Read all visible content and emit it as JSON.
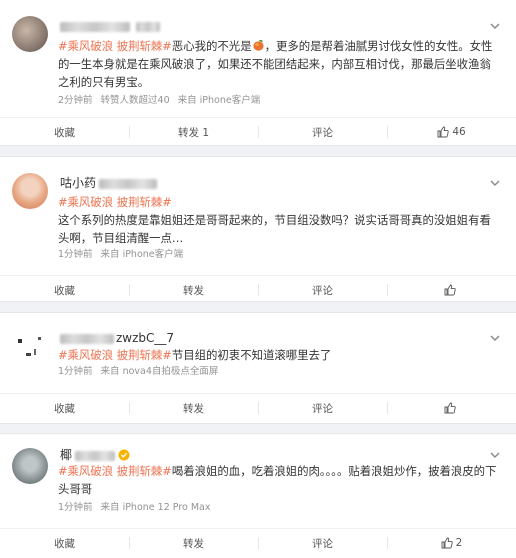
{
  "posts": [
    {
      "name_visible": "",
      "name_suffix": "",
      "text_tags": "#乘风破浪 披荆斩棘#",
      "text_1": "恶心我的不光是",
      "text_2": "，更多的是帮着油腻男讨伐女性的女性。女性的一生本身就是在乘风破浪了，如果还不能团结起来，内部互相讨伐，那最后坐收渔翁之利的只有男宝。",
      "time": "2分钟前",
      "source_prefix": "来自",
      "source": "iPhone客户端",
      "extra": "转赞人数超过40",
      "fav": "收藏",
      "repost": "转发 1",
      "comment": "评论",
      "like": "46"
    },
    {
      "name_visible": "咕小药",
      "name_suffix": "",
      "text_tags": "#乘风破浪 披荆斩棘#",
      "text_body": "这个系列的热度是靠姐姐还是哥哥起来的，节目组没数吗？说实话哥哥真的没姐姐有看头啊，节目组清醒一点…",
      "time": "1分钟前",
      "source_prefix": "来自",
      "source": "iPhone客户端",
      "fav": "收藏",
      "repost": "转发",
      "comment": "评论",
      "like": ""
    },
    {
      "name_visible": "",
      "name_suffix": "zwzbC__7",
      "text_tags": "#乘风破浪 披荆斩棘#",
      "text_body": "节目组的初衷不知道滚哪里去了",
      "time": "1分钟前",
      "source_prefix": "来自",
      "source": "nova4自拍极点全面屏",
      "fav": "收藏",
      "repost": "转发",
      "comment": "评论",
      "like": ""
    },
    {
      "name_visible": "椰",
      "name_suffix": "",
      "text_tags": "#乘风破浪 披荆斩棘#",
      "text_body": "喝着浪姐的血，吃着浪姐的肉。。。。贴着浪姐炒作，披着浪皮的下头哥哥",
      "time": "1分钟前",
      "source_prefix": "来自",
      "source": "iPhone 12 Pro Max",
      "fav": "收藏",
      "repost": "转发",
      "comment": "评论",
      "like": "2"
    }
  ],
  "colors": {
    "tag": "#eb7350",
    "meta": "#939393",
    "bg": "#f1f2f5"
  },
  "icons": [
    "chevron-down-icon",
    "repost-icon",
    "comment-icon",
    "thumbs-up-icon",
    "verified-badge-icon",
    "mango-emoji"
  ]
}
